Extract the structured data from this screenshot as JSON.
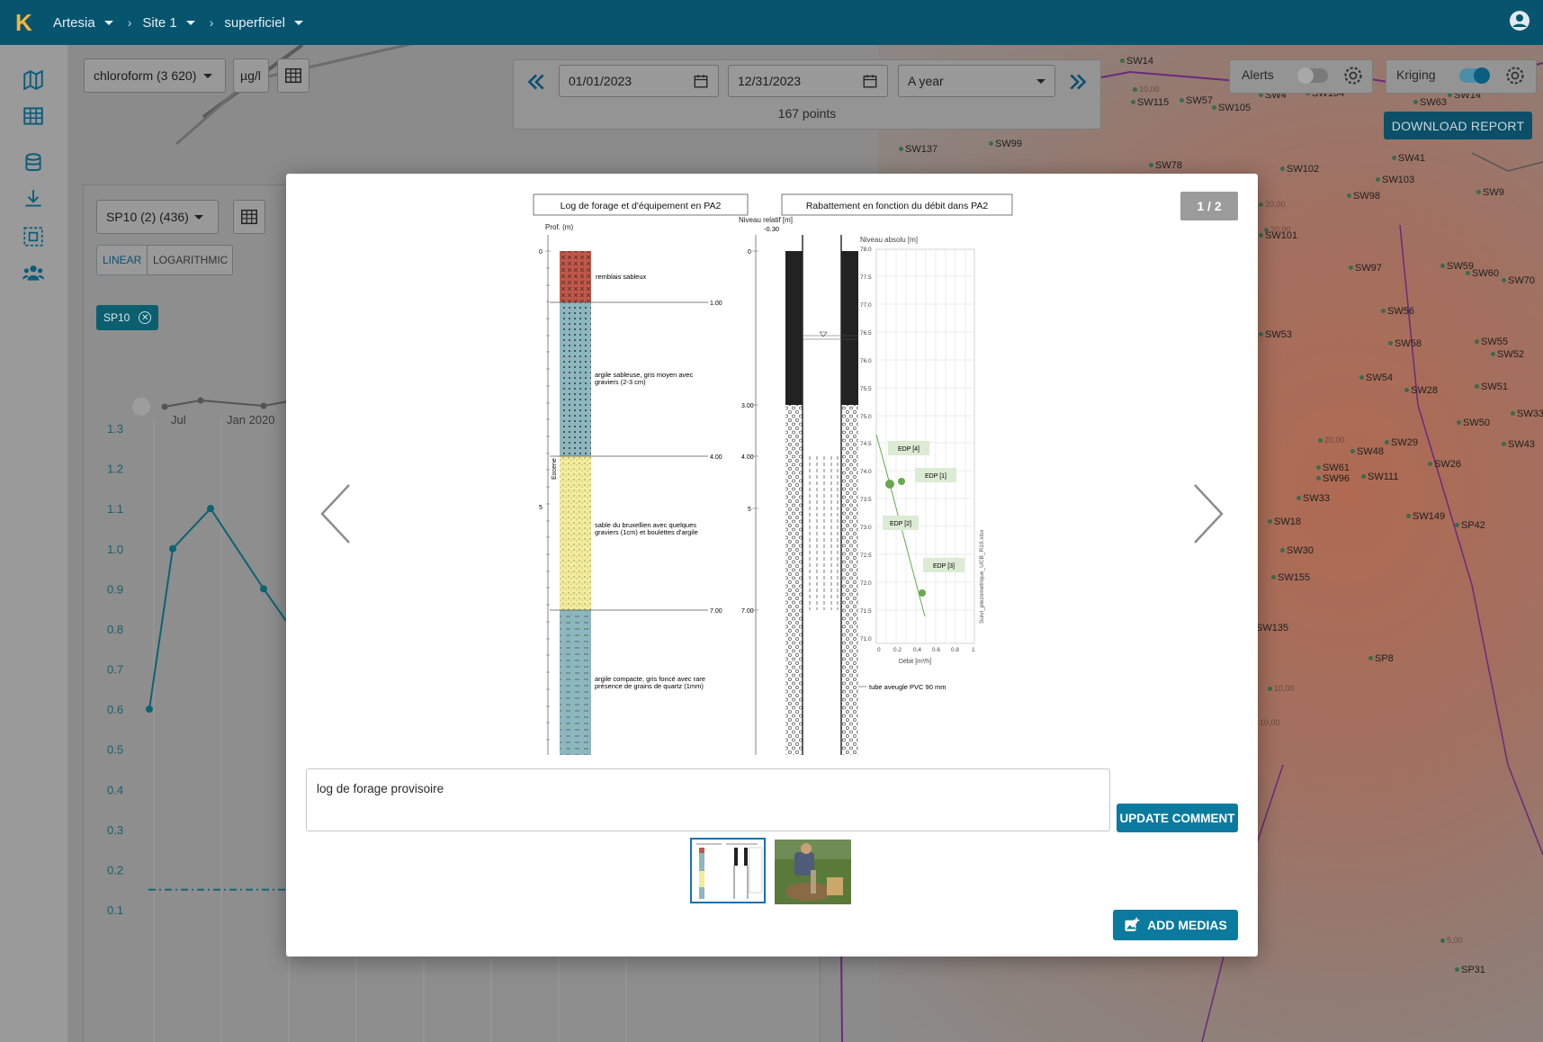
{
  "topbar": {
    "logo_letter": "K",
    "breadcrumbs": [
      "Artesia",
      "Site 1",
      "superficiel"
    ]
  },
  "map_controls": {
    "parameter_select": "chloroform (3 620)",
    "unit_select": "µg/l",
    "date_start": "01/01/2023",
    "date_end": "12/31/2023",
    "period_select": "A year",
    "points_count": "167 points",
    "alerts_label": "Alerts",
    "kriging_label": "Kriging",
    "download_report": "DOWNLOAD REPORT"
  },
  "wells": [
    {
      "label": "SW14"
    },
    {
      "label": "SW115"
    },
    {
      "label": "SW57"
    },
    {
      "label": "SW4"
    },
    {
      "label": "SW104"
    },
    {
      "label": "SW105"
    },
    {
      "label": "SW63"
    },
    {
      "label": "SW14"
    },
    {
      "label": "SW137"
    },
    {
      "label": "SW99"
    },
    {
      "label": "SW78"
    },
    {
      "label": "SW102"
    },
    {
      "label": "SW41"
    },
    {
      "label": "SW103"
    },
    {
      "label": "SW98"
    },
    {
      "label": "SW9"
    },
    {
      "label": "SW101"
    },
    {
      "label": "SW97"
    },
    {
      "label": "SW59"
    },
    {
      "label": "SW60"
    },
    {
      "label": "SW70"
    },
    {
      "label": "SW56"
    },
    {
      "label": "SW53"
    },
    {
      "label": "SW58"
    },
    {
      "label": "SW55"
    },
    {
      "label": "SW52"
    },
    {
      "label": "SW54"
    },
    {
      "label": "SW28"
    },
    {
      "label": "SW51"
    },
    {
      "label": "SW33"
    },
    {
      "label": "SW50"
    },
    {
      "label": "SW43"
    },
    {
      "label": "SW29"
    },
    {
      "label": "SW48"
    },
    {
      "label": "SW26"
    },
    {
      "label": "SW61"
    },
    {
      "label": "SW96"
    },
    {
      "label": "SW111"
    },
    {
      "label": "SW33"
    },
    {
      "label": "SW18"
    },
    {
      "label": "SW149"
    },
    {
      "label": "SP42"
    },
    {
      "label": "SW30"
    },
    {
      "label": "SW155"
    },
    {
      "label": "SW135"
    },
    {
      "label": "SP8"
    },
    {
      "label": "SP31"
    }
  ],
  "map_contours": [
    "10,00",
    "20,00",
    "20,00",
    "20,00",
    "10,00",
    "10,00",
    "5,00"
  ],
  "chart_panel": {
    "station_select": "SP10 (2) (436)",
    "scale_linear": "LINEAR",
    "scale_log": "LOGARITHMIC",
    "series_chip": "SP10",
    "nav_labels": [
      "Jul",
      "Jan 2020"
    ],
    "y_ticks": [
      "1.3",
      "1.2",
      "1.1",
      "1.0",
      "0.9",
      "0.8",
      "0.7",
      "0.6",
      "0.5",
      "0.4",
      "0.3",
      "0.2",
      "0.1"
    ]
  },
  "chart_data": {
    "type": "line",
    "series": [
      {
        "name": "SP10",
        "values": [
          0.6,
          1.0,
          1.1,
          0.9
        ]
      }
    ],
    "ylim": [
      0.1,
      1.3
    ],
    "threshold": 0.15
  },
  "modal": {
    "counter": "1 / 2",
    "comment": "log de forage provisoire",
    "update_button": "UPDATE COMMENT",
    "add_media_button": "ADD MEDIAS"
  },
  "media": {
    "title_left": "Log de forage et d'équipement en PA2",
    "title_right": "Rabattement en fonction du débit dans PA2",
    "prof_label": "Prof. (m)",
    "niveau_relatif": "Niveau relatif [m]",
    "niveau_absolu": "Niveau absolu [m]",
    "debit_label": "Débit [m³/h]",
    "side_label": "Suivi_piezometrique_UCB_R10.xlsx",
    "eocene_label": "Eocene",
    "layers": [
      {
        "text": "remblais sableux",
        "color": "#c0584a"
      },
      {
        "text": "argile sableuse, gris moyen avec graviers (2-3 cm)",
        "color": "#8db7bf"
      },
      {
        "text": "sable du bruxellien avec quelques graviers (1cm) et boulettes d'argile",
        "color": "#f3ec9a"
      },
      {
        "text": "argile compacte, gris foncé avec rare présence de grains de quartz (1mm)",
        "color": "#8db7bf"
      }
    ],
    "depth_marks": [
      "1.00",
      "4.00",
      "7.00"
    ],
    "left_ticks": [
      "0",
      "5"
    ],
    "mid_ticks": [
      "-0.30",
      "0",
      "3.00",
      "4.00",
      "5",
      "7.00"
    ],
    "abs_ticks": [
      "78.0",
      "77.5",
      "77.0",
      "76.5",
      "76.0",
      "75.5",
      "75.0",
      "74.5",
      "74.0",
      "73.5",
      "73.0",
      "72.5",
      "72.0",
      "71.5",
      "71.0"
    ],
    "debit_ticks": [
      "0",
      "0.2",
      "0.4",
      "0.6",
      "0.8",
      "1"
    ],
    "edp_labels": [
      "EDP [4]",
      "EDP [1]",
      "EDP [2]",
      "EDP [3]"
    ],
    "tube_label": "tube aveugle PVC 90 mm"
  }
}
